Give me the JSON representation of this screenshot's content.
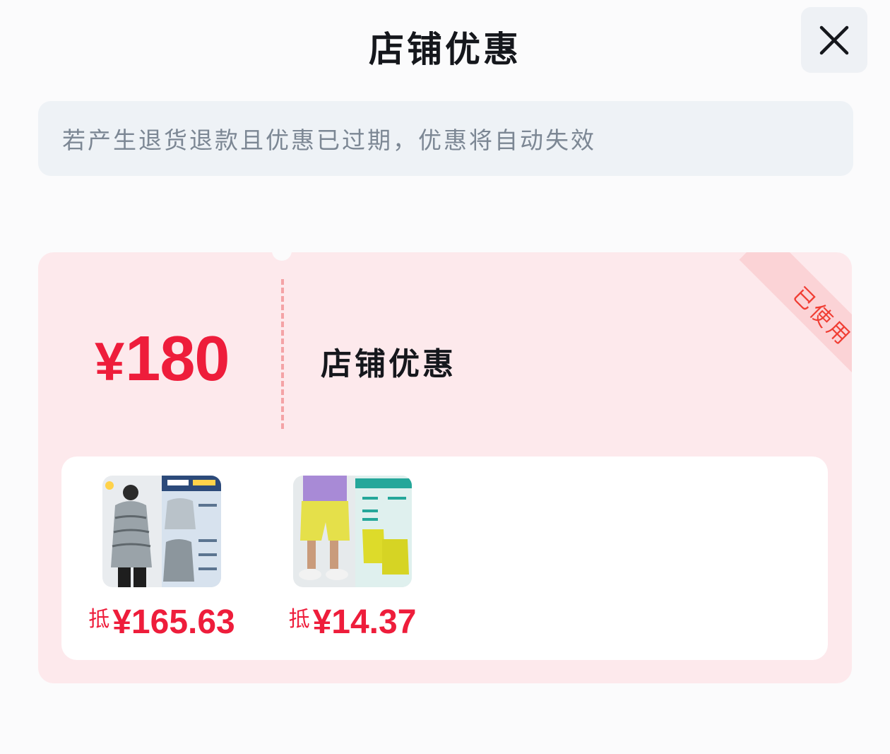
{
  "header": {
    "title": "店铺优惠",
    "close_icon": "close-icon"
  },
  "notice": {
    "text": "若产生退货退款且优惠已过期，优惠将自动失效"
  },
  "coupon": {
    "currency": "¥",
    "amount": "180",
    "name": "店铺优惠",
    "status": "已使用",
    "accent_color": "#ee1d3b"
  },
  "products": [
    {
      "label": "抵",
      "price": "¥165.63",
      "image": "down-jacket-product-image"
    },
    {
      "label": "抵",
      "price": "¥14.37",
      "image": "yellow-shorts-product-image"
    }
  ]
}
